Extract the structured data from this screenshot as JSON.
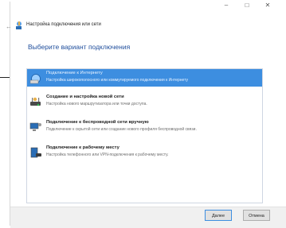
{
  "window": {
    "title": "Настройка подключения или сети",
    "controls": [
      "–",
      "□",
      "✕"
    ]
  },
  "heading": "Выберите вариант подключения",
  "options": [
    {
      "title": "Подключение к Интернету",
      "description": "Настройка широкополосного или коммутируемого подключения к Интернету",
      "icon": "globe-network-icon",
      "selected": true
    },
    {
      "title": "Создание и настройка новой сети",
      "description": "Настройка нового маршрутизатора или точки доступа.",
      "icon": "router-icon",
      "selected": false
    },
    {
      "title": "Подключение к беспроводной сети вручную",
      "description": "Подключение к скрытой сети или создание нового профиля беспроводной связи.",
      "icon": "wireless-computer-icon",
      "selected": false
    },
    {
      "title": "Подключение к рабочему месту",
      "description": "Настройка телефонного или VPN-подключения к рабочему месту.",
      "icon": "workplace-phone-icon",
      "selected": false
    }
  ],
  "buttons": {
    "next": "Далее",
    "cancel": "Отмена"
  },
  "colors": {
    "selection": "#3d8ee0",
    "heading": "#1f4e9c"
  }
}
